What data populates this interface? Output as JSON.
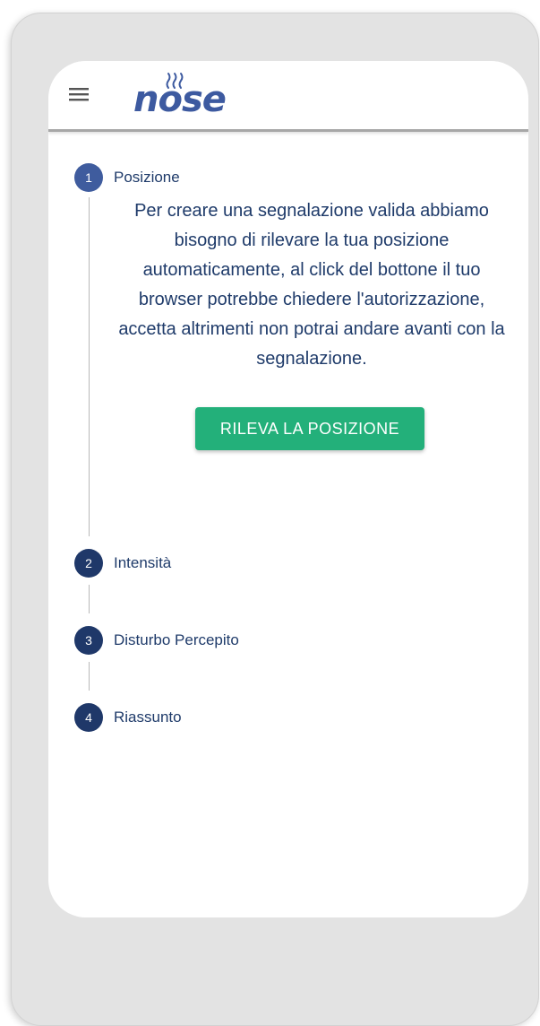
{
  "app": {
    "logo_text": "nose",
    "icons": {
      "menu": "hamburger-menu-icon",
      "logo_mark": "steam-waves-icon"
    },
    "colors": {
      "brand": "#3d5aa0",
      "step_active": "#3f5c9e",
      "step_inactive": "#1f3869",
      "text": "#1f3b6a",
      "primary_button": "#23b07a"
    }
  },
  "stepper": {
    "steps": [
      {
        "number": "1",
        "label": "Posizione",
        "state": "active"
      },
      {
        "number": "2",
        "label": "Intensità",
        "state": "inactive"
      },
      {
        "number": "3",
        "label": "Disturbo Percepito",
        "state": "inactive"
      },
      {
        "number": "4",
        "label": "Riassunto",
        "state": "inactive"
      }
    ],
    "active_step": {
      "description": "Per creare una segnalazione valida abbiamo bisogno di rilevare la tua posizione automaticamente, al click del bottone il tuo browser potrebbe chiedere l'autorizzazione, accetta altrimenti non potrai andare avanti con la segnalazione.",
      "button_label": "RILEVA LA POSIZIONE"
    }
  }
}
